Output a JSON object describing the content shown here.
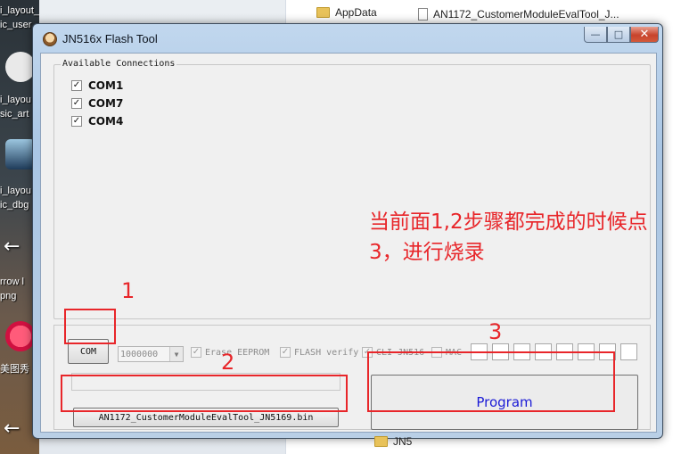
{
  "desktop": {
    "labels": [
      "i_layout_mu",
      "ic_user",
      "i_layou",
      "sic_art",
      "i_layou",
      "ic_dbg",
      "rrow l",
      "png",
      "美图秀"
    ]
  },
  "explorer": {
    "items": [
      "AppData",
      "AN1172_CustomerModuleEvalTool_J..."
    ],
    "bottom_item": "JN5"
  },
  "window": {
    "title": "JN516x Flash Tool",
    "min_glyph": "—",
    "max_glyph": "□",
    "close_glyph": "✕"
  },
  "connections": {
    "legend": "Available Connections",
    "items": [
      {
        "label": "COM1",
        "checked": true
      },
      {
        "label": "COM7",
        "checked": true
      },
      {
        "label": "COM4",
        "checked": true
      }
    ]
  },
  "annotation": {
    "text": "当前面1,2步骤都完成的时候点3，进行烧录",
    "markers": [
      "1",
      "2",
      "3"
    ]
  },
  "controls": {
    "com_button": "COM",
    "baud_rate": "1000000",
    "erase_label": "Erase EEPROM",
    "verify_label": "FLASH verify",
    "cli_label": "CLI JN516",
    "mac_label": "MAC",
    "file_button": "AN1172_CustomerModuleEvalTool_JN5169.bin",
    "program_button": "Program"
  },
  "colors": {
    "annotation_red": "#e8262a",
    "program_text": "#1a1ad6"
  }
}
